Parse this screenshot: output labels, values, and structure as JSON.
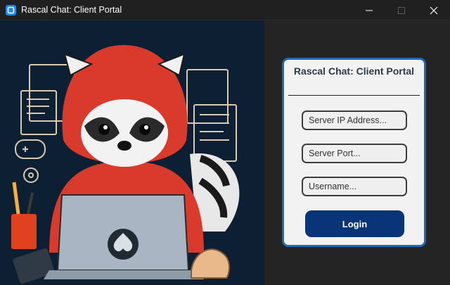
{
  "window": {
    "title": "Rascal Chat: Client Portal",
    "icon": "app-icon"
  },
  "login": {
    "heading": "Rascal Chat: Client Portal",
    "server_ip_placeholder": "Server IP Address...",
    "server_port_placeholder": "Server Port...",
    "username_placeholder": "Username...",
    "login_label": "Login"
  },
  "colors": {
    "art_background": "#0d1f33",
    "card_border": "#1f6ab8",
    "button": "#0a3478",
    "titlebar": "#202020"
  }
}
